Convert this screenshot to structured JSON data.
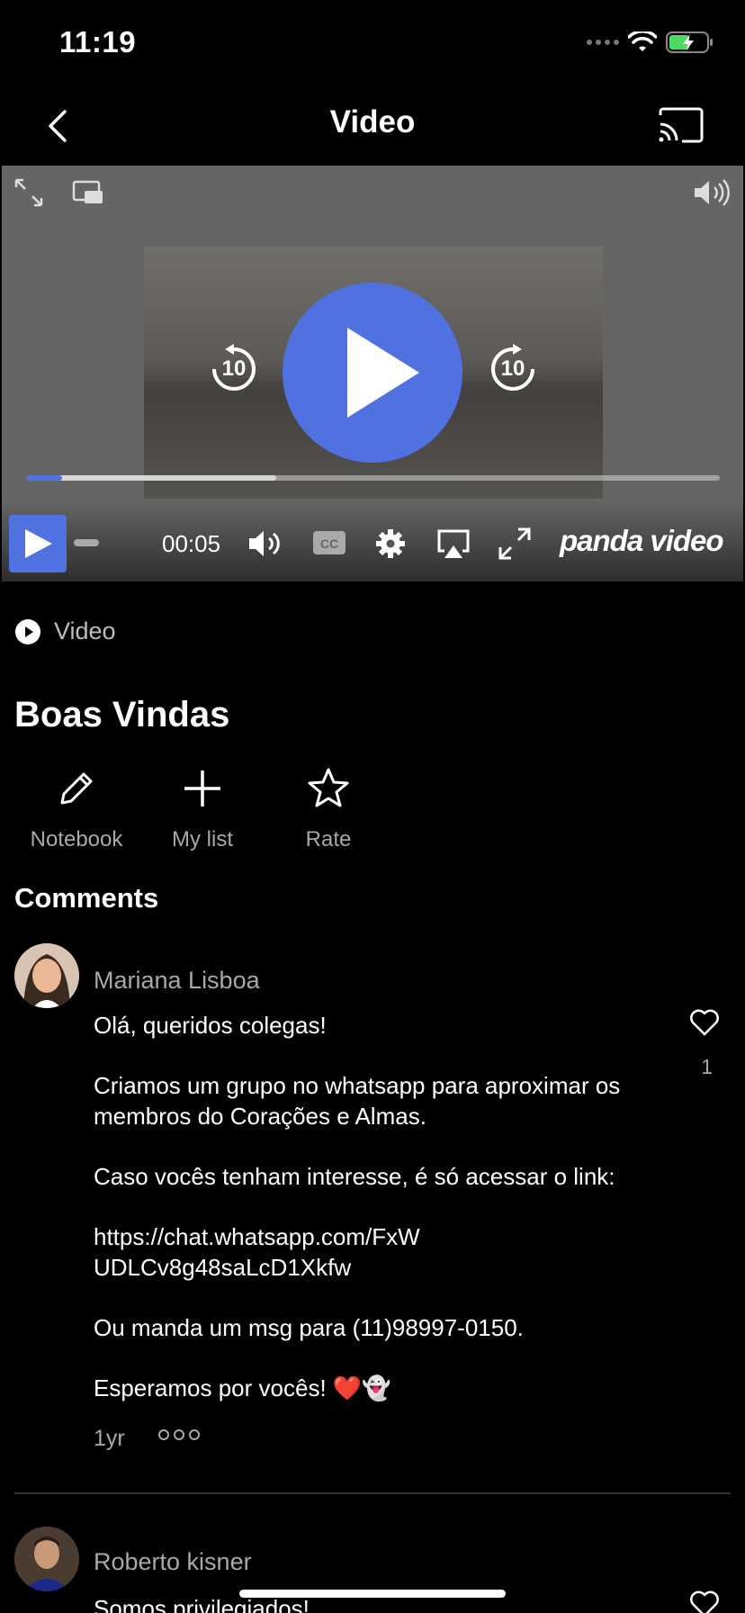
{
  "status_bar": {
    "time": "11:19",
    "battery_color": "#4cd964"
  },
  "nav": {
    "title": "Video"
  },
  "video": {
    "current_time": "00:05",
    "progress_played": 0.05,
    "progress_buffered": 0.36,
    "seek_back_label": "10",
    "seek_forward_label": "10",
    "brand": "panda video",
    "accent_color": "#4f72e0"
  },
  "content": {
    "type_label": "Video",
    "title": "Boas Vindas",
    "actions": [
      {
        "icon": "pencil-icon",
        "label": "Notebook"
      },
      {
        "icon": "plus-icon",
        "label": "My list"
      },
      {
        "icon": "star-icon",
        "label": "Rate"
      }
    ]
  },
  "comments": {
    "heading": "Comments",
    "items": [
      {
        "author": "Mariana Lisboa",
        "paragraphs": [
          "Olá, queridos colegas!",
          "Criamos um grupo no whatsapp para aproximar os membros do Corações e Almas.",
          "Caso vocês tenham interesse, é só acessar o link:",
          "https://chat.whatsapp.com/FxWUDLCv8g48saLcD1Xkfw",
          "Ou manda um msg para (11)98997-0150.",
          "Esperamos por vocês! ❤️👻"
        ],
        "likes": "1",
        "time": "1yr"
      },
      {
        "author": "Roberto kisner",
        "paragraphs": [
          "Somos privilegiados!"
        ]
      }
    ]
  }
}
